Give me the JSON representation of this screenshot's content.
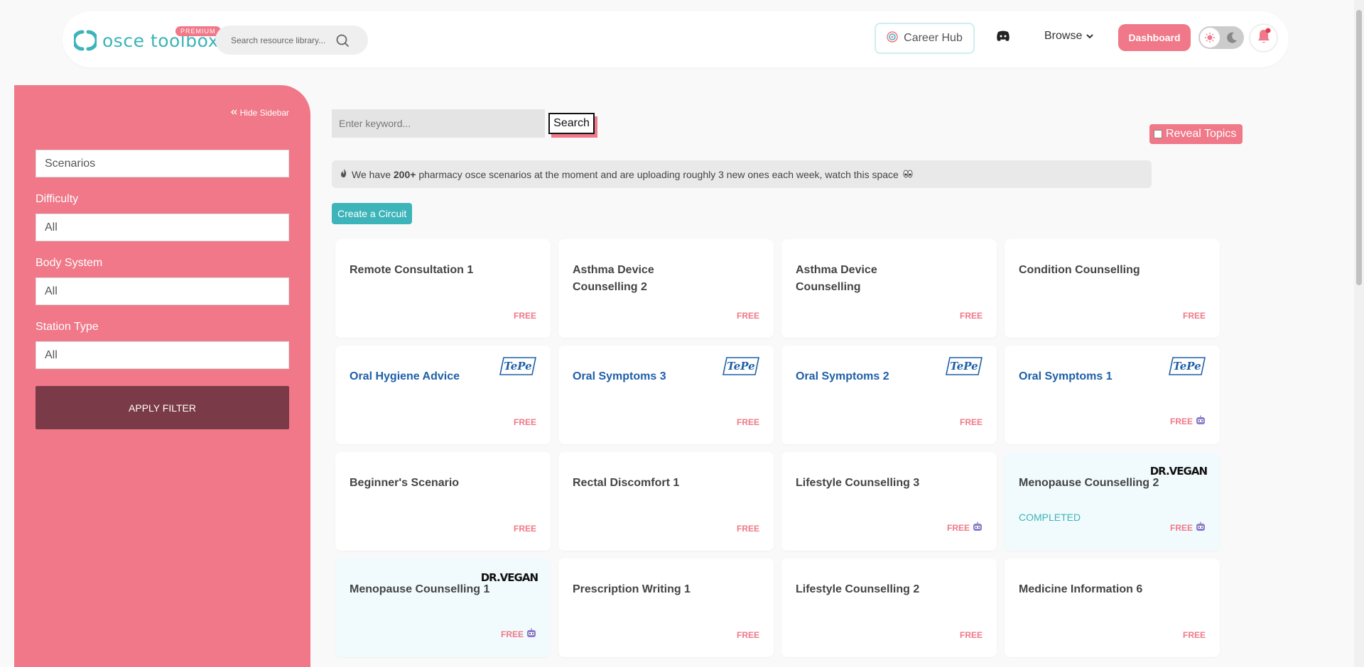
{
  "nav": {
    "logo_text": "osce toolbox",
    "premium_badge": "PREMIUM",
    "search_placeholder": "Search resource library...",
    "career_hub": "Career Hub",
    "browse": "Browse",
    "dashboard": "Dashboard"
  },
  "sidebar": {
    "hide_label": "Hide Sidebar",
    "category_value": "Scenarios",
    "difficulty_label": "Difficulty",
    "difficulty_value": "All",
    "body_system_label": "Body System",
    "body_system_value": "All",
    "station_type_label": "Station Type",
    "station_type_value": "All",
    "apply_label": "APPLY FILTER"
  },
  "main": {
    "keyword_placeholder": "Enter keyword...",
    "search_label": "Search",
    "reveal_label": "Reveal Topics",
    "info_pre": "We have ",
    "info_bold": "200+",
    "info_post": " pharmacy osce scenarios at the moment and are uploading roughly 3 new ones each week, watch this space",
    "circuit_label": "Create a Circuit"
  },
  "cards": [
    {
      "title": "Remote Consultation 1",
      "badge": "FREE"
    },
    {
      "title": "Asthma Device Counselling 2",
      "badge": "FREE"
    },
    {
      "title": "Asthma Device Counselling",
      "badge": "FREE"
    },
    {
      "title": "Condition Counselling",
      "badge": "FREE"
    },
    {
      "title": "Oral Hygiene Advice",
      "badge": "FREE",
      "brand": "TePe"
    },
    {
      "title": "Oral Symptoms 3",
      "badge": "FREE",
      "brand": "TePe"
    },
    {
      "title": "Oral Symptoms 2",
      "badge": "FREE",
      "brand": "TePe"
    },
    {
      "title": "Oral Symptoms 1",
      "badge": "FREE",
      "brand": "TePe",
      "bot": true
    },
    {
      "title": "Beginner's Scenario",
      "badge": "FREE"
    },
    {
      "title": "Rectal Discomfort 1",
      "badge": "FREE"
    },
    {
      "title": "Lifestyle Counselling 3",
      "badge": "FREE",
      "bot": true
    },
    {
      "title": "Menopause Counselling 2",
      "badge": "FREE",
      "brand": "DR.VEGAN",
      "bot": true,
      "completed": "COMPLETED"
    },
    {
      "title": "Menopause Counselling 1",
      "badge": "FREE",
      "brand": "DR.VEGAN",
      "bot": true,
      "tinted": true
    },
    {
      "title": "Prescription Writing 1",
      "badge": "FREE"
    },
    {
      "title": "Lifestyle Counselling 2",
      "badge": "FREE"
    },
    {
      "title": "Medicine Information 6",
      "badge": "FREE"
    }
  ],
  "colors": {
    "accent_pink": "#f07888",
    "accent_teal": "#3cb4b9",
    "tepe_blue": "#1e5fa8",
    "apply_maroon": "#7a3a47"
  }
}
